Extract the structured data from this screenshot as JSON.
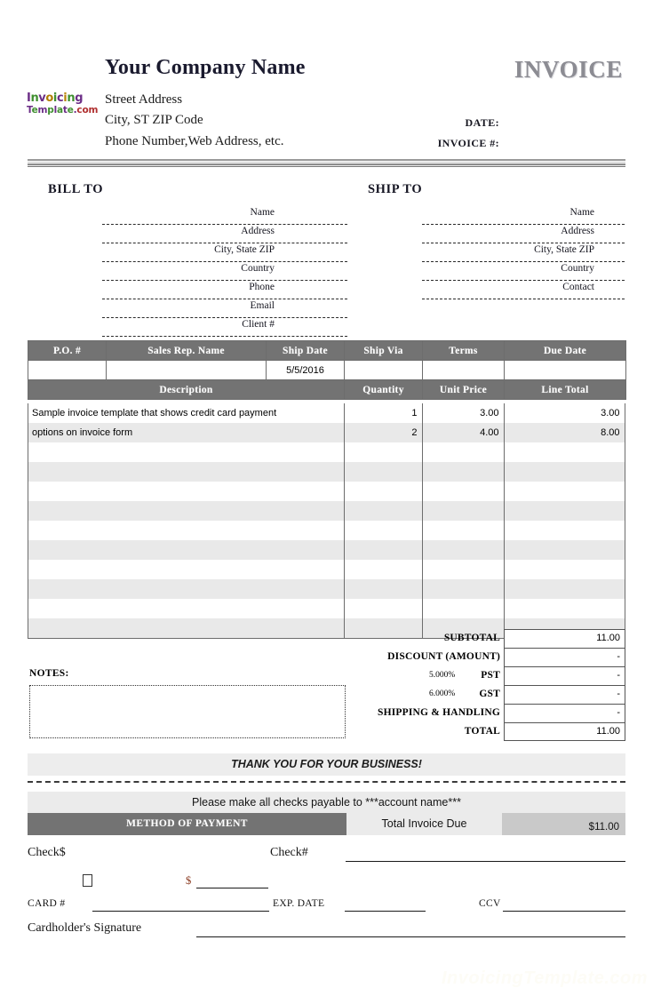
{
  "document": {
    "type": "invoice-template",
    "title_word": "INVOICE"
  },
  "header": {
    "company_name": "Your Company Name",
    "address_line_1": "Street Address",
    "address_line_2": "City, ST  ZIP Code",
    "address_line_3": "Phone Number,Web Address, etc.",
    "logo": {
      "line1": "Invoicing",
      "line2": "Template.com",
      "colors": [
        "#6b2d86",
        "#3f8f2f",
        "#6b2d86",
        "#d18a00",
        "#3f8f2f",
        "#6b2d86",
        "#b8860b",
        "#3f8f2f",
        "#6b2d86"
      ]
    },
    "date_label": "DATE:",
    "date_value": "",
    "invoice_number_label": "INVOICE #:",
    "invoice_number_value": ""
  },
  "bill_to": {
    "title": "BILL TO",
    "fields": [
      {
        "label": "Name",
        "value": ""
      },
      {
        "label": "Address",
        "value": ""
      },
      {
        "label": "City, State ZIP",
        "value": ""
      },
      {
        "label": "Country",
        "value": ""
      },
      {
        "label": "Phone",
        "value": ""
      },
      {
        "label": "Email",
        "value": ""
      },
      {
        "label": "Client #",
        "value": ""
      }
    ]
  },
  "ship_to": {
    "title": "SHIP TO",
    "fields": [
      {
        "label": "Name",
        "value": ""
      },
      {
        "label": "Address",
        "value": ""
      },
      {
        "label": "City, State ZIP",
        "value": ""
      },
      {
        "label": "Country",
        "value": ""
      },
      {
        "label": "Contact",
        "value": ""
      }
    ]
  },
  "order_info": {
    "headers": [
      "P.O. #",
      "Sales Rep. Name",
      "Ship Date",
      "Ship Via",
      "Terms",
      "Due Date"
    ],
    "values": [
      "",
      "",
      "5/5/2016",
      "",
      "",
      ""
    ]
  },
  "items_table": {
    "headers": [
      "Description",
      "Quantity",
      "Unit Price",
      "Line Total"
    ],
    "rows": [
      {
        "description": "Sample invoice template that shows credit card payment",
        "quantity": "1",
        "unit_price": "3.00",
        "line_total": "3.00"
      },
      {
        "description": "options on invoice form",
        "quantity": "2",
        "unit_price": "4.00",
        "line_total": "8.00"
      },
      {
        "description": "",
        "quantity": "",
        "unit_price": "",
        "line_total": ""
      },
      {
        "description": "",
        "quantity": "",
        "unit_price": "",
        "line_total": ""
      },
      {
        "description": "",
        "quantity": "",
        "unit_price": "",
        "line_total": ""
      },
      {
        "description": "",
        "quantity": "",
        "unit_price": "",
        "line_total": ""
      },
      {
        "description": "",
        "quantity": "",
        "unit_price": "",
        "line_total": ""
      },
      {
        "description": "",
        "quantity": "",
        "unit_price": "",
        "line_total": ""
      },
      {
        "description": "",
        "quantity": "",
        "unit_price": "",
        "line_total": ""
      },
      {
        "description": "",
        "quantity": "",
        "unit_price": "",
        "line_total": ""
      },
      {
        "description": "",
        "quantity": "",
        "unit_price": "",
        "line_total": ""
      },
      {
        "description": "",
        "quantity": "",
        "unit_price": "",
        "line_total": ""
      }
    ]
  },
  "totals": [
    {
      "label": "SUBTOTAL",
      "rate": "",
      "value": "11.00"
    },
    {
      "label": "DISCOUNT (AMOUNT)",
      "rate": "",
      "value": "-"
    },
    {
      "label": "PST",
      "rate": "5.000%",
      "value": "-"
    },
    {
      "label": "GST",
      "rate": "6.000%",
      "value": "-"
    },
    {
      "label": "SHIPPING & HANDLING",
      "rate": "",
      "value": "-"
    },
    {
      "label": "TOTAL",
      "rate": "",
      "value": "11.00"
    }
  ],
  "notes": {
    "label": "NOTES:",
    "value": ""
  },
  "footer": {
    "thank_you": "THANK YOU FOR YOUR BUSINESS!",
    "payable_note": "Please make all checks payable to ***account name***",
    "method_of_payment_label": "METHOD OF PAYMENT",
    "total_invoice_due_label": "Total Invoice Due",
    "total_invoice_due_value": "$11.00"
  },
  "payment_block": {
    "check_amount_label": "Check$",
    "check_number_label": "Check#",
    "check_number_value": "",
    "card_checkbox_checked": false,
    "card_amount_symbol": "$",
    "card_amount_value": "",
    "card_number_label": "CARD #",
    "card_number_value": "",
    "exp_date_label": "EXP. DATE",
    "exp_date_value": "",
    "ccv_label": "CCV",
    "ccv_value": "",
    "signature_label": "Cardholder's Signature",
    "signature_value": ""
  },
  "watermark": {
    "text": "InvoicingTemplate.com"
  },
  "colors": {
    "header_gray": "#737373",
    "row_alt_gray": "#e9e9e9",
    "band_gray": "#ebebeb",
    "due_gray": "#c9c9c9",
    "invoice_word": "#8c8c93"
  }
}
